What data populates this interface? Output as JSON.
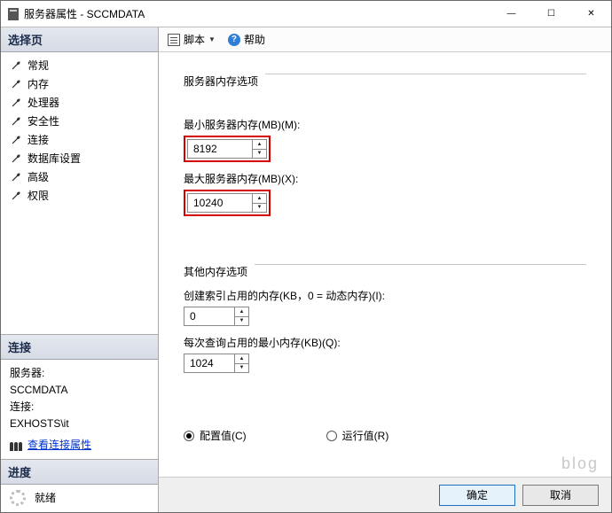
{
  "window": {
    "title": "服务器属性 - SCCMDATA"
  },
  "win": {
    "min": "—",
    "max": "☐",
    "close": "✕"
  },
  "sidebar": {
    "select_header": "选择页",
    "items": [
      {
        "label": "常规"
      },
      {
        "label": "内存"
      },
      {
        "label": "处理器"
      },
      {
        "label": "安全性"
      },
      {
        "label": "连接"
      },
      {
        "label": "数据库设置"
      },
      {
        "label": "高级"
      },
      {
        "label": "权限"
      }
    ],
    "conn_header": "连接",
    "server_lbl": "服务器:",
    "server_val": "SCCMDATA",
    "conn_lbl": "连接:",
    "conn_val": "EXHOSTS\\it",
    "view_conn_link": "查看连接属性",
    "progress_header": "进度",
    "ready": "就绪"
  },
  "toolbar": {
    "script": "脚本",
    "help": "帮助"
  },
  "content": {
    "group1": "服务器内存选项",
    "min_label": "最小服务器内存(MB)(M):",
    "min_value": "8192",
    "max_label": "最大服务器内存(MB)(X):",
    "max_value": "10240",
    "group2": "其他内存选项",
    "index_label": "创建索引占用的内存(KB，0 = 动态内存)(I):",
    "index_value": "0",
    "query_label": "每次查询占用的最小内存(KB)(Q):",
    "query_value": "1024",
    "radio_config": "配置值(C)",
    "radio_run": "运行值(R)"
  },
  "footer": {
    "ok": "确定",
    "cancel": "取消"
  },
  "watermark": "blog"
}
